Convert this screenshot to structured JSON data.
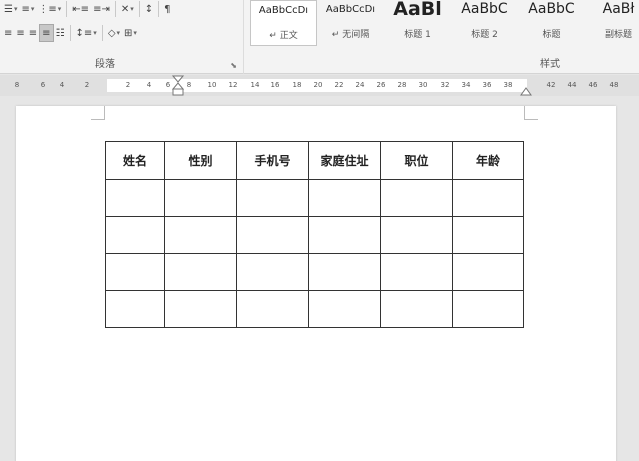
{
  "ribbon": {
    "paragraph": {
      "label": "段落",
      "row1_icons": [
        "bullets-icon",
        "numbering-icon",
        "multilevel-list-icon",
        "decrease-indent-icon",
        "increase-indent-icon",
        "chinese-layout-icon",
        "sort-icon",
        "show-marks-icon"
      ],
      "row2_icons": [
        "align-left-icon",
        "align-center-icon",
        "align-right-icon",
        "justify-icon",
        "distributed-icon",
        "line-spacing-icon",
        "shading-icon",
        "borders-icon"
      ]
    },
    "styles": {
      "label": "样式",
      "items": [
        {
          "preview": "AaBbCcDı",
          "name": "↵ 正文"
        },
        {
          "preview": "AaBbCcDı",
          "name": "↵ 无间隔"
        },
        {
          "preview": "AaBl",
          "name": "标题 1"
        },
        {
          "preview": "AaBbC",
          "name": "标题 2"
        },
        {
          "preview": "AaBbC",
          "name": "标题"
        },
        {
          "preview": "AaBł",
          "name": "副标题"
        }
      ]
    }
  },
  "ruler": {
    "left_numbers": [
      "8",
      "6",
      "4",
      "2"
    ],
    "numbers": [
      "2",
      "4",
      "6",
      "8",
      "10",
      "12",
      "14",
      "16",
      "18",
      "20",
      "22",
      "24",
      "26",
      "28",
      "30",
      "32",
      "34",
      "36",
      "38",
      "42",
      "44",
      "46",
      "48"
    ]
  },
  "table": {
    "headers": [
      "姓名",
      "性别",
      "手机号",
      "家庭住址",
      "职位",
      "年龄"
    ],
    "rows": [
      [
        "",
        "",
        "",
        "",
        "",
        ""
      ],
      [
        "",
        "",
        "",
        "",
        "",
        ""
      ],
      [
        "",
        "",
        "",
        "",
        "",
        ""
      ],
      [
        "",
        "",
        "",
        "",
        "",
        ""
      ]
    ]
  }
}
